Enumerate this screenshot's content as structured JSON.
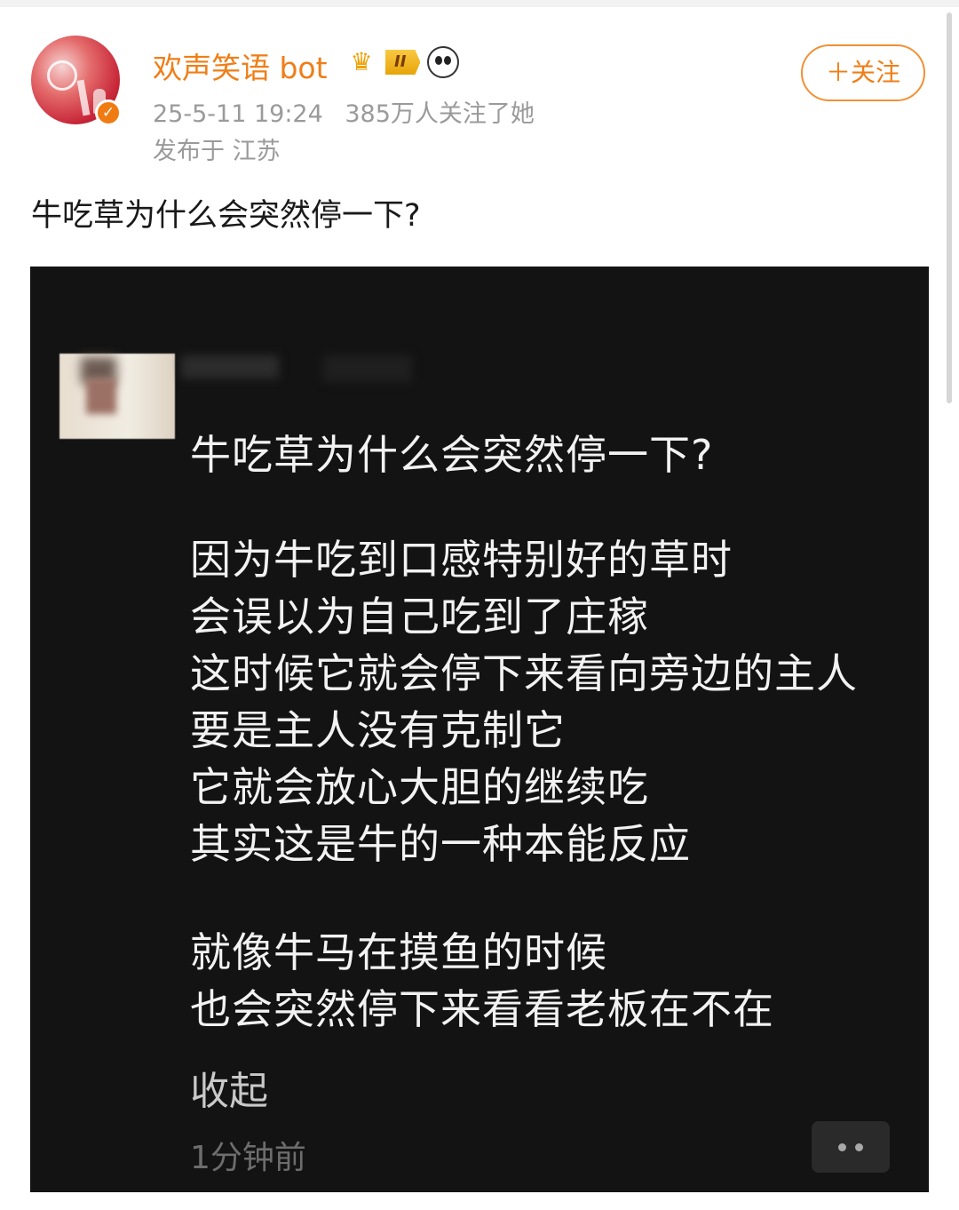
{
  "post": {
    "username": "欢声笑语 bot",
    "level_badge": "II",
    "date": "25-5-11 19:24",
    "followers": "385万人关注了她",
    "location": "发布于 江苏",
    "follow_label": "＋关注",
    "text": "牛吃草为什么会突然停一下?"
  },
  "screenshot": {
    "question": "牛吃草为什么会突然停一下?",
    "answer_lines": [
      "因为牛吃到口感特别好的草时",
      "会误以为自己吃到了庄稼",
      "这时候它就会停下来看向旁边的主人",
      "要是主人没有克制它",
      "它就会放心大胆的继续吃",
      "其实这是牛的一种本能反应"
    ],
    "joke_lines": [
      "就像牛马在摸鱼的时候",
      "也会突然停下来看看老板在不在"
    ],
    "collapse_label": "收起",
    "time_ago": "1分钟前"
  },
  "icons": {
    "verified": "verified-badge-icon",
    "crown": "crown-icon",
    "panda": "panda-icon",
    "more": "more-dots-icon"
  },
  "colors": {
    "accent": "#ef7e17",
    "meta_text": "#9a9a9a",
    "screenshot_bg": "#131313"
  }
}
